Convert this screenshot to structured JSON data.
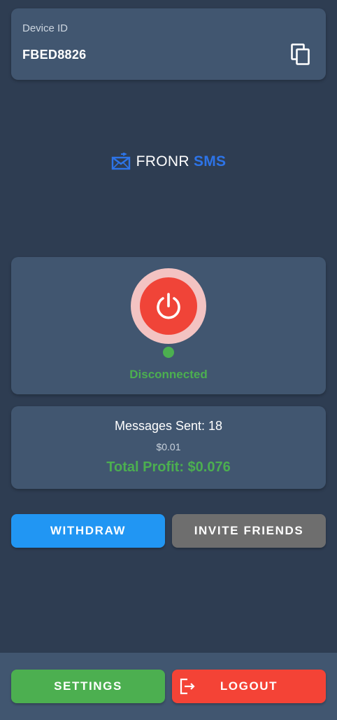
{
  "device": {
    "label": "Device ID",
    "id": "FBED8826",
    "copy_icon": "copy-icon"
  },
  "logo": {
    "icon": "envelope-icon",
    "word1": "FRONR",
    "word2": "SMS"
  },
  "status": {
    "power_icon": "power-icon",
    "text": "Disconnected",
    "color": "#4caf50"
  },
  "stats": {
    "messages_sent": "Messages Sent: 18",
    "rate": "$0.01",
    "total_profit": "Total Profit: $0.076"
  },
  "actions": {
    "withdraw": "WITHDRAW",
    "invite": "INVITE FRIENDS"
  },
  "footer": {
    "settings": "SETTINGS",
    "logout": "LOGOUT",
    "logout_icon": "logout-icon"
  },
  "colors": {
    "background": "#2e3d52",
    "card": "#415670",
    "accent_blue": "#2196f3",
    "brand_blue": "#2d74e8",
    "success_green": "#4caf50",
    "danger_red": "#f44336",
    "neutral_gray": "#6e6e6e"
  }
}
